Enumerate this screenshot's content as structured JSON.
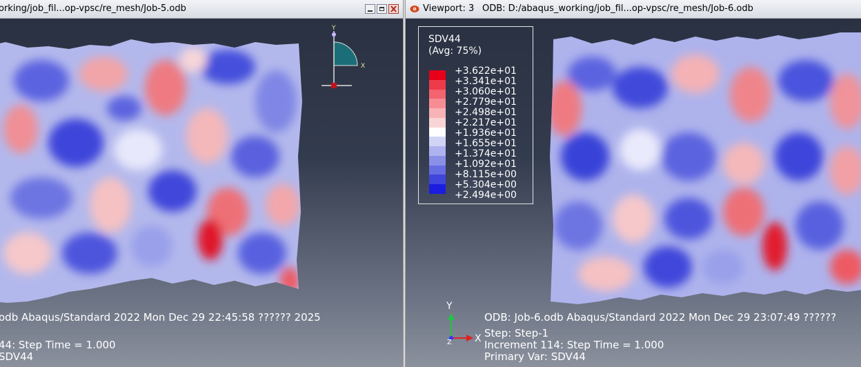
{
  "left_viewport": {
    "title": "orking/job_fil...op-vpsc/re_mesh/Job-5.odb",
    "info_line": "odb     Abaqus/Standard 2022     Mon Dec 29 22:45:58 ?????? 2025",
    "step_line": "44: Step Time =     1.000",
    "var_line": "SDV44",
    "triad": {
      "y_label": "Y",
      "x_label": "X"
    },
    "window_buttons": [
      "minimize-button",
      "restore-button",
      "close-button"
    ]
  },
  "right_viewport": {
    "viewport_label": "Viewport: 3",
    "odb_path": "ODB: D:/abaqus_working/job_fil...op-vpsc/re_mesh/Job-6.odb",
    "legend": {
      "title": "SDV44",
      "subtitle": "(Avg: 75%)",
      "values": [
        "+3.622e+01",
        "+3.341e+01",
        "+3.060e+01",
        "+2.779e+01",
        "+2.498e+01",
        "+2.217e+01",
        "+1.936e+01",
        "+1.655e+01",
        "+1.374e+01",
        "+1.092e+01",
        "+8.115e+00",
        "+5.304e+00",
        "+2.494e+00"
      ],
      "colors": [
        "#e8001a",
        "#ee3b4a",
        "#f3646e",
        "#f68d93",
        "#f8b3b6",
        "#fad5d6",
        "#ffffff",
        "#d2d4f6",
        "#aeb2ef",
        "#8a8fe8",
        "#666ce1",
        "#3f46dc",
        "#1a1ddf"
      ]
    },
    "triad": {
      "y_label": "Y",
      "x_label": "X",
      "z_label": "Z"
    },
    "odb_line": "ODB: Job-6.odb     Abaqus/Standard 2022     Mon Dec 29 23:07:49 ??????",
    "step_name": "Step: Step-1",
    "increment_line": "Increment     114: Step Time =     1.000",
    "primary_var": "Primary Var: SDV44"
  }
}
